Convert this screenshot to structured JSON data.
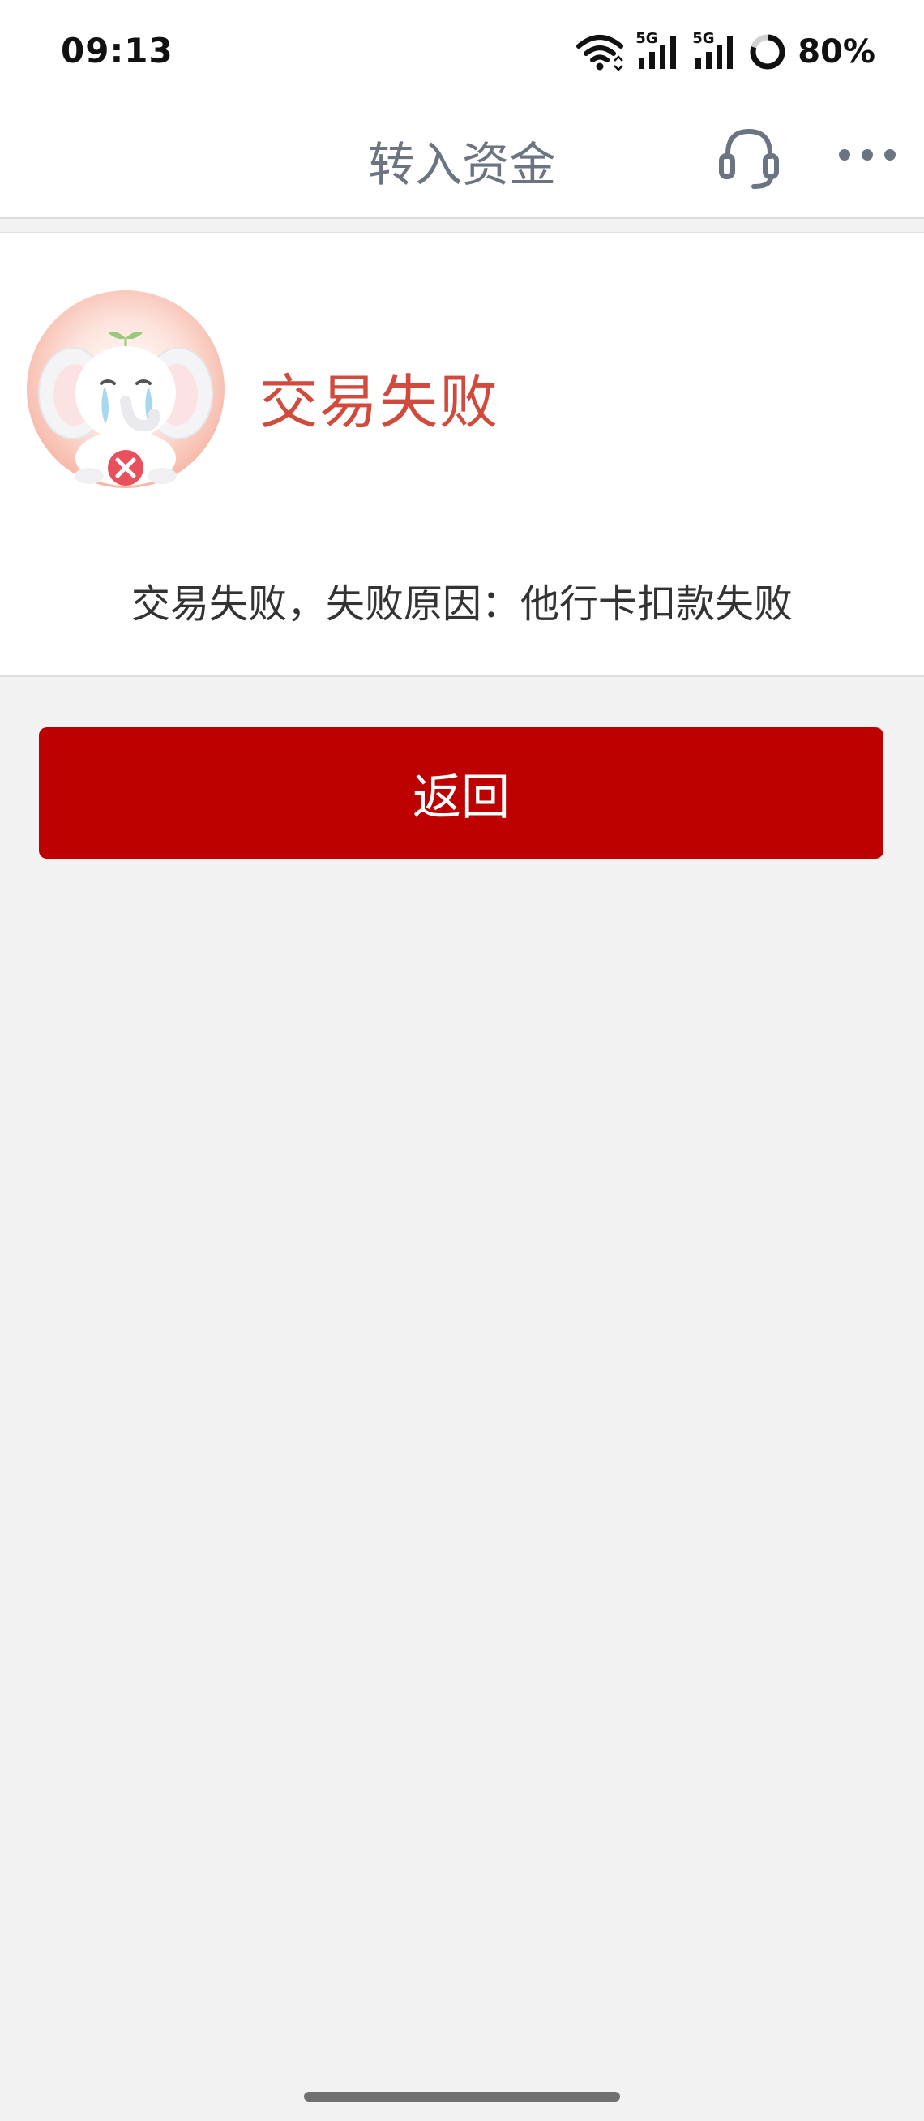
{
  "status_bar": {
    "time": "09:13",
    "signal_1_label": "5G",
    "signal_2_label": "5G",
    "battery": "80%",
    "icons": [
      "wifi-icon",
      "signal-5g-icon",
      "signal-5g-icon",
      "battery-ring-icon"
    ]
  },
  "nav": {
    "title": "转入资金",
    "customer_service_icon": "headset-icon",
    "more_icon": "more-dots-icon"
  },
  "result": {
    "status": "交易失败",
    "reason": "交易失败，失败原因：他行卡扣款失败",
    "mascot_icon": "sad-elephant-icon",
    "status_color": "#d24a3b"
  },
  "actions": {
    "return_label": "返回",
    "button_color": "#bd0000"
  }
}
